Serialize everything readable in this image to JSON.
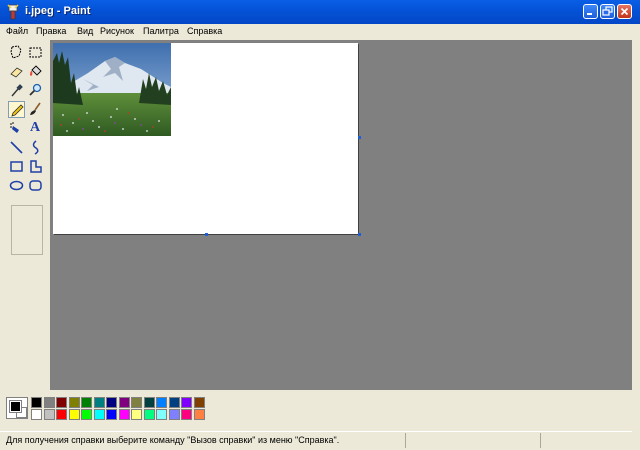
{
  "window": {
    "title": "i.jpeg - Paint",
    "icon": "paint-app-icon",
    "minimize_icon": "minimize-icon",
    "restore_icon": "restore-icon",
    "close_icon": "close-icon"
  },
  "menu": [
    "Файл",
    "Правка",
    "Вид",
    "Рисунок",
    "Палитра",
    "Справка"
  ],
  "tools": [
    {
      "name": "free-form-select-icon"
    },
    {
      "name": "rect-select-icon"
    },
    {
      "name": "eraser-icon"
    },
    {
      "name": "fill-bucket-icon"
    },
    {
      "name": "color-picker-icon"
    },
    {
      "name": "magnifier-icon"
    },
    {
      "name": "pencil-icon",
      "active": true
    },
    {
      "name": "brush-icon"
    },
    {
      "name": "airbrush-icon"
    },
    {
      "name": "text-icon",
      "glyph": "A"
    },
    {
      "name": "line-icon"
    },
    {
      "name": "curve-icon"
    },
    {
      "name": "rectangle-icon"
    },
    {
      "name": "polygon-icon"
    },
    {
      "name": "ellipse-icon"
    },
    {
      "name": "rounded-rect-icon"
    }
  ],
  "palette": {
    "foreground": "#000000",
    "background": "#ffffff",
    "row1": [
      "#000000",
      "#808080",
      "#800000",
      "#808000",
      "#008000",
      "#008080",
      "#000080",
      "#800080",
      "#808040",
      "#004040",
      "#0080ff",
      "#004080",
      "#8000ff",
      "#804000"
    ],
    "row2": [
      "#ffffff",
      "#c0c0c0",
      "#ff0000",
      "#ffff00",
      "#00ff00",
      "#00ffff",
      "#0000ff",
      "#ff00ff",
      "#ffff80",
      "#00ff80",
      "#80ffff",
      "#8080ff",
      "#ff0080",
      "#ff8040"
    ]
  },
  "status": {
    "text": "Для получения справки выберите команду \"Вызов справки\" из меню \"Справка\"."
  }
}
